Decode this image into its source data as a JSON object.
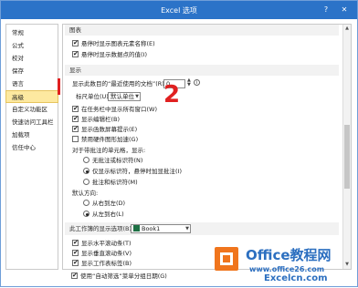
{
  "window": {
    "title": "Excel 选项"
  },
  "sidebar": {
    "items": [
      {
        "label": "常规"
      },
      {
        "label": "公式"
      },
      {
        "label": "校对"
      },
      {
        "label": "保存"
      },
      {
        "label": "语言"
      },
      {
        "label": "高级",
        "active": true
      },
      {
        "label": "自定义功能区"
      },
      {
        "label": "快速访问工具栏"
      },
      {
        "label": "加载项"
      },
      {
        "label": "信任中心"
      }
    ]
  },
  "charts_section": {
    "header": "图表",
    "items": [
      {
        "label": "悬停时显示图表元素名称(E)",
        "checked": true
      },
      {
        "label": "悬停时显示数据点的值(I)",
        "checked": true
      }
    ]
  },
  "display_section": {
    "header": "显示",
    "recent_docs_label": "显示此数目的“最近使用的文档”(R):",
    "recent_docs_value": "0",
    "ruler_units_label": "标尺单位(U)",
    "ruler_units_value": "默认单位",
    "items": [
      {
        "label": "在任务栏中显示所有窗口(W)",
        "checked": true
      },
      {
        "label": "显示编辑栏(B)",
        "checked": true
      },
      {
        "label": "显示函数屏幕提示(E)",
        "checked": true
      },
      {
        "label": "禁用硬件图形加速(G)",
        "checked": false
      }
    ],
    "comments_label": "对于带批注的单元格，显示:",
    "comments_options": [
      {
        "label": "无批注或标识符(N)",
        "checked": false
      },
      {
        "label": "仅显示标识符，悬停时加显批注(I)",
        "checked": true
      },
      {
        "label": "批注和标识符(M)",
        "checked": false
      }
    ],
    "direction_label": "默认方向:",
    "direction_options": [
      {
        "label": "从右到左(D)",
        "checked": false
      },
      {
        "label": "从左到右(L)",
        "checked": true
      }
    ]
  },
  "workbook_section": {
    "header": "此工作簿的显示选项(B):",
    "workbook_value": "Book1",
    "items": [
      {
        "label": "显示水平滚动条(T)",
        "checked": true
      },
      {
        "label": "显示垂直滚动条(V)",
        "checked": true
      },
      {
        "label": "显示工作表标签(B)",
        "checked": true
      },
      {
        "label": "使用“自动筛选”菜单分组日期(G)",
        "checked": true
      }
    ]
  },
  "annotation": {
    "step_number": "2"
  },
  "watermark": {
    "title": "Office教程网",
    "sub": "www.office26.com",
    "sub2": "Excelcn.com"
  },
  "colors": {
    "titlebar": "#2b73c8",
    "annotation": "#e02020",
    "watermark": "#2c6fc0",
    "logo_orange": "#f0751d"
  }
}
